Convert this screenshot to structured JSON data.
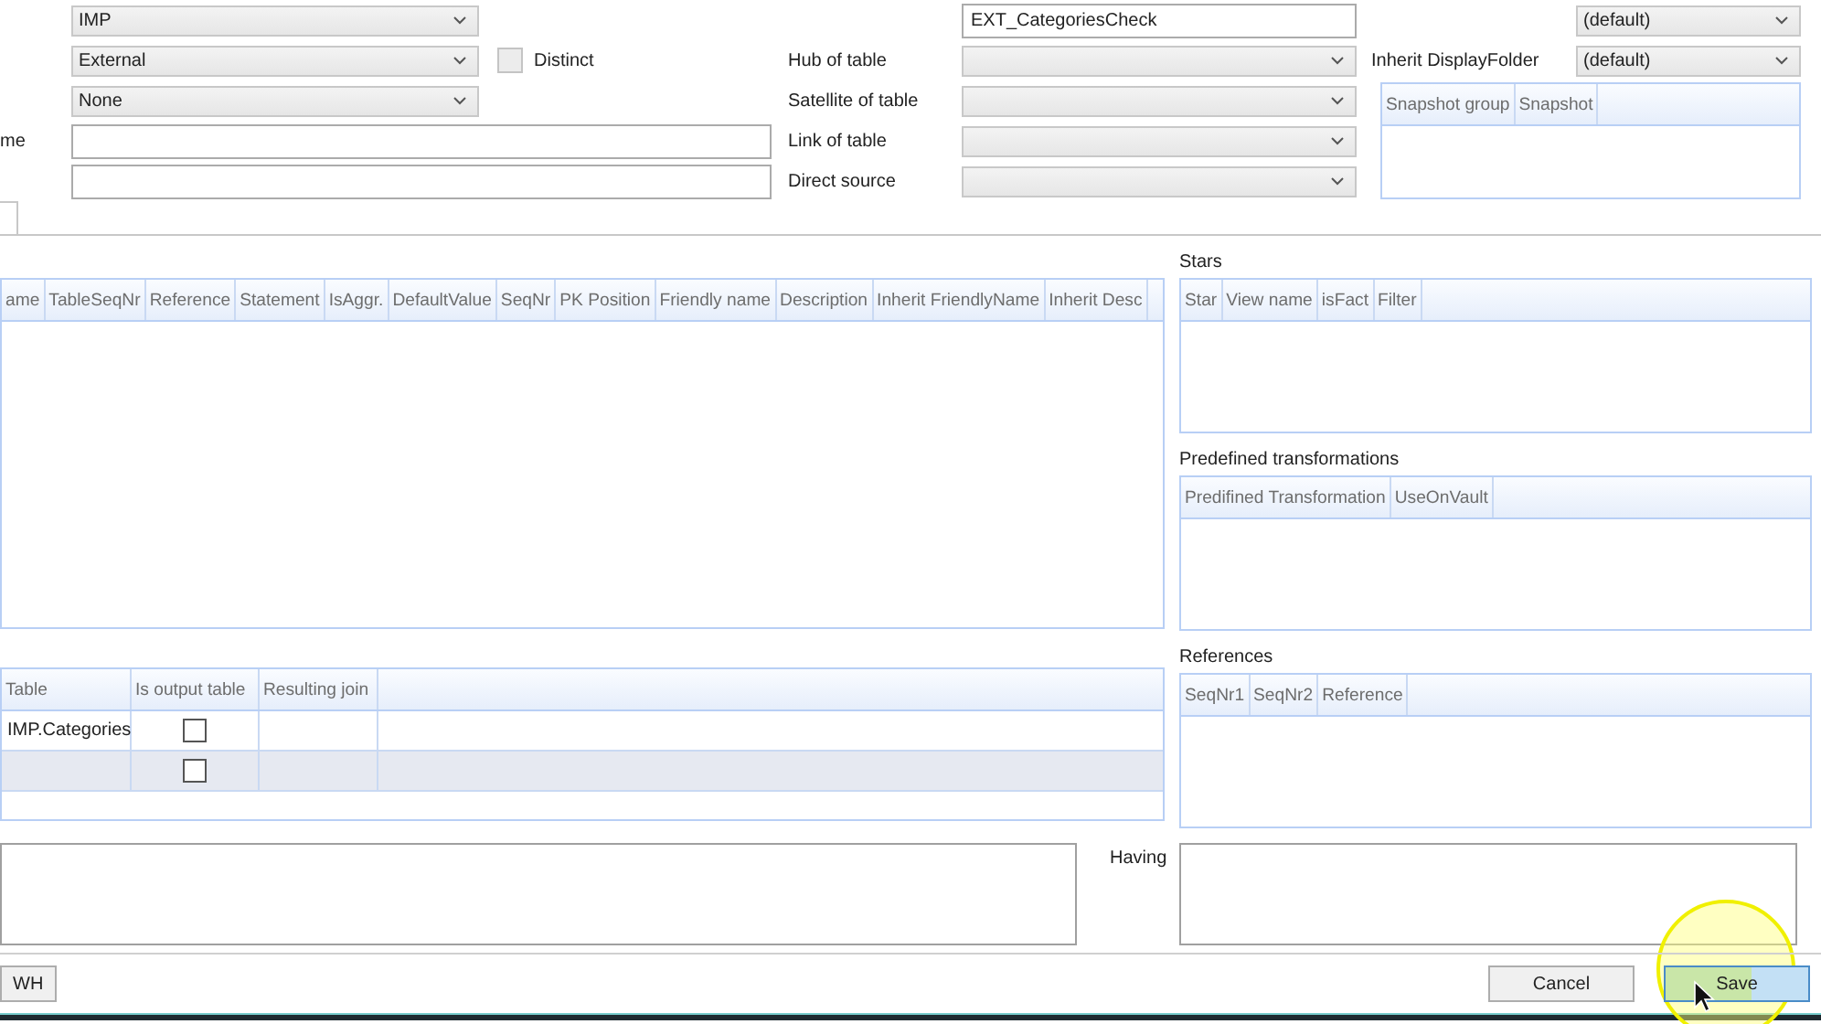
{
  "form": {
    "left_fields": [
      {
        "kind": "dropdown",
        "value": "IMP"
      },
      {
        "kind": "dropdown",
        "value": "External"
      },
      {
        "kind": "dropdown",
        "value": "None"
      },
      {
        "kind": "text",
        "label": "me"
      },
      {
        "kind": "text"
      }
    ],
    "checkboxes": [
      {
        "label": "Distinct",
        "checked": false
      }
    ],
    "middle_fields": [
      {
        "kind": "text",
        "value": "EXT_CategoriesCheck"
      },
      {
        "kind": "dropdown",
        "label": "Hub of table"
      },
      {
        "kind": "dropdown",
        "label": "Satellite of table"
      },
      {
        "kind": "dropdown",
        "label": "Link of table"
      },
      {
        "kind": "dropdown",
        "label": "Direct source"
      }
    ],
    "right_fields": [
      {
        "kind": "dropdown",
        "value": "(default)"
      },
      {
        "kind": "dropdown",
        "label": "Inherit DisplayFolder",
        "value": "(default)"
      }
    ],
    "snapshot_grid": {
      "columns": [
        "Snapshot group",
        "Snapshot"
      ]
    }
  },
  "columns_grid": {
    "columns": [
      "ame",
      "TableSeqNr",
      "Reference",
      "Statement",
      "IsAggr.",
      "DefaultValue",
      "SeqNr",
      "PK Position",
      "Friendly name",
      "Description",
      "Inherit FriendlyName",
      "Inherit Desc"
    ]
  },
  "joins_grid": {
    "columns": [
      "Table",
      "Is output table",
      "Resulting join"
    ],
    "rows": [
      {
        "table": "IMP.Categories",
        "is_output_table": false,
        "selected": false
      },
      {
        "is_output_table": false,
        "selected": true
      }
    ]
  },
  "side_panels": [
    {
      "title": "Stars",
      "columns": [
        "Star",
        "View name",
        "isFact",
        "Filter"
      ]
    },
    {
      "title": "Predefined transformations",
      "columns": [
        "Predifined Transformation",
        "UseOnVault"
      ]
    },
    {
      "title": "References",
      "columns": [
        "SeqNr1",
        "SeqNr2",
        "Reference"
      ]
    }
  ],
  "having_label": "Having",
  "buttons": [
    {
      "label": "WH",
      "kind": "plain"
    },
    {
      "label": "Cancel",
      "kind": "plain"
    },
    {
      "label": "Save",
      "kind": "primary"
    }
  ]
}
